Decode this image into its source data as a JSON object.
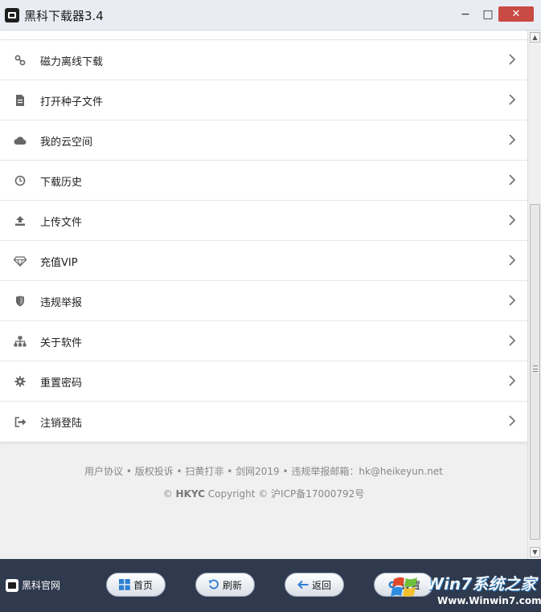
{
  "window": {
    "title": "黑科下载器3.4",
    "minimize": "−",
    "maximize": "□",
    "close": "✕"
  },
  "menu": {
    "items": [
      {
        "label": "磁力离线下载",
        "icon": "magnet-link-icon"
      },
      {
        "label": "打开种子文件",
        "icon": "file-icon"
      },
      {
        "label": "我的云空间",
        "icon": "cloud-icon"
      },
      {
        "label": "下载历史",
        "icon": "clock-icon"
      },
      {
        "label": "上传文件",
        "icon": "upload-icon"
      },
      {
        "label": "充值VIP",
        "icon": "diamond-icon"
      },
      {
        "label": "违规举报",
        "icon": "shield-icon"
      },
      {
        "label": "关于软件",
        "icon": "sitemap-icon"
      },
      {
        "label": "重置密码",
        "icon": "gear-icon"
      },
      {
        "label": "注销登陆",
        "icon": "sign-out-icon"
      }
    ]
  },
  "footer": {
    "links": "用户协议 • 版权投诉 • 扫黄打非 • 剑网2019 • 违规举报邮箱：hk@heikeyun.net",
    "copyright_symbol": "©",
    "copyright_brand": "HKYC",
    "copyright_rest": "Copyright © 沪ICP备17000792号"
  },
  "bottombar": {
    "brand": "黑科官网",
    "home": "首页",
    "refresh": "刷新",
    "back": "返回",
    "settings": "设置"
  },
  "watermark": {
    "title": "Win7系统之家",
    "url": "Www.Winwin7.com"
  },
  "colors": {
    "titlebar": "#e9ecf2",
    "close_button": "#c94a42",
    "bottombar": "#2f3a4e",
    "content_bg": "#f0f0f0"
  }
}
